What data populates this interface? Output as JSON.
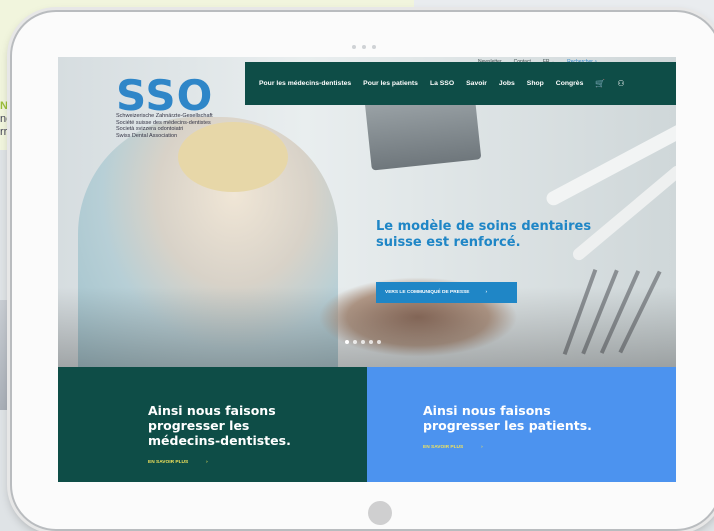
{
  "background": {
    "fragment_lines": [
      "NI",
      "ne",
      "rr"
    ]
  },
  "site": {
    "logo": "SSO",
    "tagline": [
      "Schweizerische Zahnärzte-Gesellschaft",
      "Société suisse des médecins-dentistes",
      "Società svizzera odontoiatri",
      "Swiss Dental Association"
    ],
    "topbar": {
      "newsletter": "Newsletter",
      "contact": "Contact",
      "language": "FR",
      "search": "Rechercher"
    },
    "nav": [
      "Pour les médecins-dentistes",
      "Pour les patients",
      "La SSO",
      "Savoir",
      "Jobs",
      "Shop",
      "Congrès"
    ],
    "hero": {
      "headline": "Le modèle de soins dentaires suisse est renforcé.",
      "cta": "VERS LE COMMUNIQUÉ DE PRESSE",
      "cta_arrow": "›"
    },
    "panels": [
      {
        "title": "Ainsi nous faisons progresser les médecins-dentistes.",
        "more": "EN SAVOIR PLUS",
        "arrow": "›"
      },
      {
        "title": "Ainsi nous faisons progresser les patients.",
        "more": "EN SAVOIR PLUS",
        "arrow": "›"
      }
    ]
  },
  "colors": {
    "brand_green": "#0e4d47",
    "brand_blue": "#1f86c6",
    "panel_blue": "#4c93ef",
    "accent_yellow": "#f1e25b"
  },
  "icons": [
    "cart-icon",
    "user-icon",
    "search-icon",
    "chevron-right-icon",
    "chevron-down-icon"
  ]
}
